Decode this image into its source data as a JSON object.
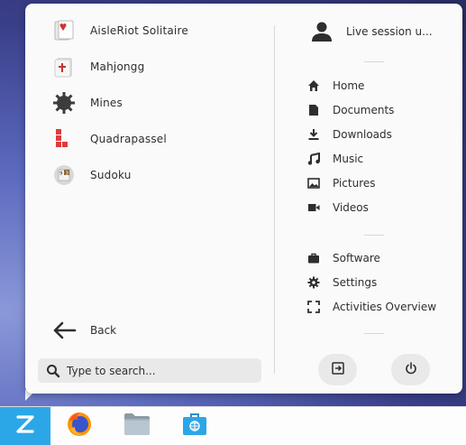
{
  "apps": [
    {
      "label": "AisleRiot Solitaire",
      "icon": "aisleriot-icon"
    },
    {
      "label": "Mahjongg",
      "icon": "mahjongg-icon"
    },
    {
      "label": "Mines",
      "icon": "mines-icon"
    },
    {
      "label": "Quadrapassel",
      "icon": "quadrapassel-icon"
    },
    {
      "label": "Sudoku",
      "icon": "sudoku-icon"
    }
  ],
  "back_label": "Back",
  "search": {
    "placeholder": "Type to search..."
  },
  "user": {
    "label": "Live session u..."
  },
  "places": [
    {
      "label": "Home",
      "icon": "home-icon"
    },
    {
      "label": "Documents",
      "icon": "document-icon"
    },
    {
      "label": "Downloads",
      "icon": "download-icon"
    },
    {
      "label": "Music",
      "icon": "music-icon"
    },
    {
      "label": "Pictures",
      "icon": "picture-icon"
    },
    {
      "label": "Videos",
      "icon": "video-icon"
    }
  ],
  "system": [
    {
      "label": "Software",
      "icon": "briefcase-icon"
    },
    {
      "label": "Settings",
      "icon": "gear-icon"
    },
    {
      "label": "Activities Overview",
      "icon": "fullscreen-icon"
    }
  ],
  "taskbar": [
    "zorin-menu-icon",
    "firefox-icon",
    "files-icon",
    "software-store-icon"
  ],
  "sudoku_tile": "9 3",
  "colors": {
    "accent": "#2ba7e8",
    "panel": "#fafafa"
  }
}
